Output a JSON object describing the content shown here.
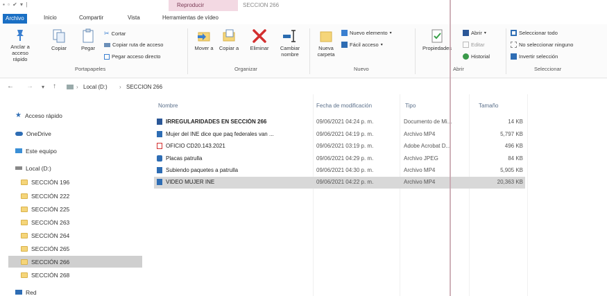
{
  "titlebar": {
    "quick_access": "▪ ▫ ✔ ▾ |",
    "context_group": "Reproducir",
    "folder_title": "SECCION 266"
  },
  "tabs": [
    {
      "label": "Archivo"
    },
    {
      "label": "Inicio"
    },
    {
      "label": "Compartir"
    },
    {
      "label": "Vista"
    },
    {
      "label": "Herramientas de vídeo"
    }
  ],
  "ribbon": {
    "clipboard": {
      "pin": "Anclar a acceso rápido",
      "copy": "Copiar",
      "paste": "Pegar",
      "cut": "Cortar",
      "copy_path": "Copiar ruta de acceso",
      "paste_shortcut": "Pegar acceso directo",
      "group": "Portapapeles"
    },
    "organize": {
      "move": "Mover a",
      "copy_to": "Copiar a",
      "delete": "Eliminar",
      "rename": "Cambiar nombre",
      "group": "Organizar"
    },
    "new": {
      "new_folder": "Nueva carpeta",
      "new_item": "Nuevo elemento",
      "easy_access": "Fácil acceso",
      "group": "Nuevo"
    },
    "open": {
      "properties": "Propiedades",
      "open": "Abrir",
      "edit": "Editar",
      "history": "Historial",
      "group": "Abrir"
    },
    "select": {
      "select_all": "Seleccionar todo",
      "select_none": "No seleccionar ninguno",
      "invert": "Invertir selección",
      "group": "Seleccionar"
    }
  },
  "address": {
    "back": "←",
    "forward": "→",
    "recent": "▾",
    "up": "↑",
    "crumbs": [
      "Local (D:)",
      "SECCION 266"
    ],
    "separator": "›"
  },
  "nav_pane": {
    "quick_access": "Acceso rápido",
    "onedrive": "OneDrive",
    "this_pc": "Este equipo",
    "drive": "Local (D:)",
    "folders": [
      "SECCIÓN 196",
      "SECCIÓN 222",
      "SECCIÓN 225",
      "SECCIÓN 263",
      "SECCIÓN 264",
      "SECCIÓN 265",
      "SECCIÓN 266",
      "SECCIÓN 268"
    ],
    "selected_folder": "SECCIÓN 266",
    "network": "Red"
  },
  "columns": {
    "name": "Nombre",
    "date": "Fecha de modificación",
    "type": "Tipo",
    "size": "Tamaño"
  },
  "files": [
    {
      "name": "IRREGULARIDADES EN SECCIÓN 266",
      "date": "09/06/2021 04:24 p. m.",
      "type": "Documento de Mi...",
      "size": "14 KB",
      "icon": "word-icon",
      "color": "#2b5797"
    },
    {
      "name": "Mujer del INE dice que paq federales van ...",
      "date": "09/06/2021 04:19 p. m.",
      "type": "Archivo MP4",
      "size": "5,797 KB",
      "icon": "video-icon",
      "color": "#2e6db4"
    },
    {
      "name": "OFICIO CD20.143.2021",
      "date": "09/06/2021 03:19 p. m.",
      "type": "Adobe Acrobat D...",
      "size": "496 KB",
      "icon": "pdf-icon",
      "color": "#d32f2f"
    },
    {
      "name": "Placas patrulla",
      "date": "09/06/2021 04:29 p. m.",
      "type": "Archivo JPEG",
      "size": "84 KB",
      "icon": "image-icon",
      "color": "#2e6db4"
    },
    {
      "name": "Subiendo paquetes a patrulla",
      "date": "09/06/2021 04:30 p. m.",
      "type": "Archivo MP4",
      "size": "5,905 KB",
      "icon": "video-icon",
      "color": "#2e6db4"
    },
    {
      "name": "VIDEO MUJER INE",
      "date": "09/06/2021 04:22 p. m.",
      "type": "Archivo MP4",
      "size": "20,363 KB",
      "icon": "video-icon",
      "color": "#2e6db4",
      "selected": true
    }
  ]
}
